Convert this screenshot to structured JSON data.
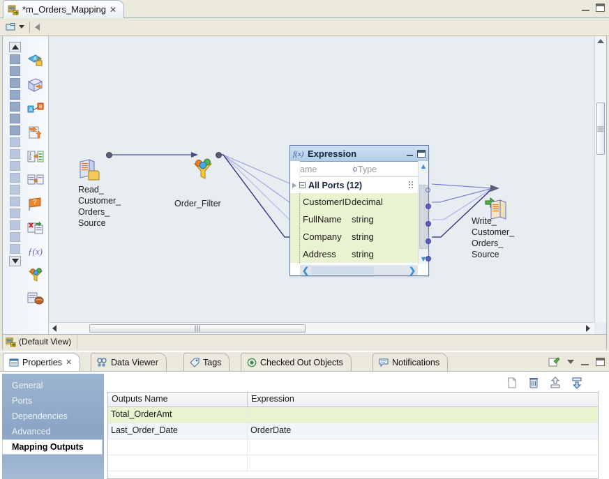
{
  "editor": {
    "tab": {
      "title": "*m_Orders_Mapping",
      "close": "✕",
      "icon": "mapping-icon"
    },
    "toolbar": {
      "folder_icon": "folder-dropdown-icon",
      "back_icon": "back-arrow-icon"
    },
    "window_controls": {
      "minimize": "minimize-icon",
      "maximize": "maximize-icon"
    },
    "status": {
      "view_label": "(Default View)",
      "icon": "mapping-icon"
    }
  },
  "palette": {
    "icons": [
      "lookup-transformation-icon",
      "aggregator-transformation-icon",
      "expression-transformation-icon",
      "update-strategy-icon",
      "sorter-transformation-icon",
      "router-transformation-icon",
      "rank-transformation-icon",
      "union-transformation-icon",
      "joiner-transformation-icon",
      "filter-transformation-icon",
      "java-transformation-icon"
    ]
  },
  "canvas": {
    "nodes": [
      {
        "id": "source",
        "label": "Read_\nCustomer_\nOrders_\nSource",
        "icon": "read-source-icon"
      },
      {
        "id": "filter",
        "label": "Order_Filter",
        "icon": "filter-icon"
      },
      {
        "id": "target",
        "label": "Write_\nCustomer_\nOrders_\nSource",
        "icon": "write-target-icon"
      }
    ]
  },
  "expression": {
    "title": "Expression",
    "icon": "function-icon",
    "columns": {
      "name": "Name",
      "type": "Type"
    },
    "group": {
      "label": "All Ports (12)"
    },
    "ports": [
      {
        "name": "CustomerID",
        "type": "decimal"
      },
      {
        "name": "FullName",
        "type": "string"
      },
      {
        "name": "Company",
        "type": "string"
      },
      {
        "name": "Address",
        "type": "string"
      }
    ],
    "window_controls": {
      "minimize": "minimize-icon",
      "maximize": "maximize-icon"
    },
    "scroll": {
      "up": "▲",
      "down": "▼",
      "left": "❮",
      "right": "❯"
    }
  },
  "properties": {
    "tabs": [
      {
        "label": "Properties",
        "icon": "properties-icon",
        "active": true,
        "closeable": true,
        "close": "✕"
      },
      {
        "label": "Data Viewer",
        "icon": "data-viewer-icon",
        "active": false
      },
      {
        "label": "Tags",
        "icon": "tag-icon",
        "active": false
      },
      {
        "label": "Checked Out Objects",
        "icon": "checked-out-icon",
        "active": false
      },
      {
        "label": "Notifications",
        "icon": "notification-icon",
        "active": false
      }
    ],
    "view_controls": {
      "pin": "pin-view-icon",
      "menu": "view-menu-icon",
      "minimize": "minimize-icon",
      "maximize": "maximize-icon"
    },
    "nav": [
      {
        "label": "General",
        "selected": false
      },
      {
        "label": "Ports",
        "selected": false
      },
      {
        "label": "Dependencies",
        "selected": false
      },
      {
        "label": "Advanced",
        "selected": false
      },
      {
        "label": "Mapping Outputs",
        "selected": true
      }
    ],
    "table_toolbar": [
      {
        "icon": "new-icon"
      },
      {
        "icon": "delete-icon"
      },
      {
        "icon": "move-up-icon"
      },
      {
        "icon": "move-down-icon"
      }
    ],
    "table": {
      "columns": [
        "Outputs Name",
        "Expression"
      ],
      "rows": [
        {
          "name": "Total_OrderAmt",
          "expression": "",
          "style": "green"
        },
        {
          "name": "Last_Order_Date",
          "expression": "OrderDate",
          "style": "blue"
        },
        {
          "name": "",
          "expression": "",
          "style": "empty"
        },
        {
          "name": "",
          "expression": "",
          "style": "empty"
        }
      ]
    }
  },
  "colors": {
    "tab_active": "#ffffff",
    "chrome": "#ebe8dc",
    "canvas": "#e8edf2",
    "port_row": "#eaf3cf",
    "nav_gradient_top": "#9cb4cf",
    "link": "#3a8fd4"
  }
}
